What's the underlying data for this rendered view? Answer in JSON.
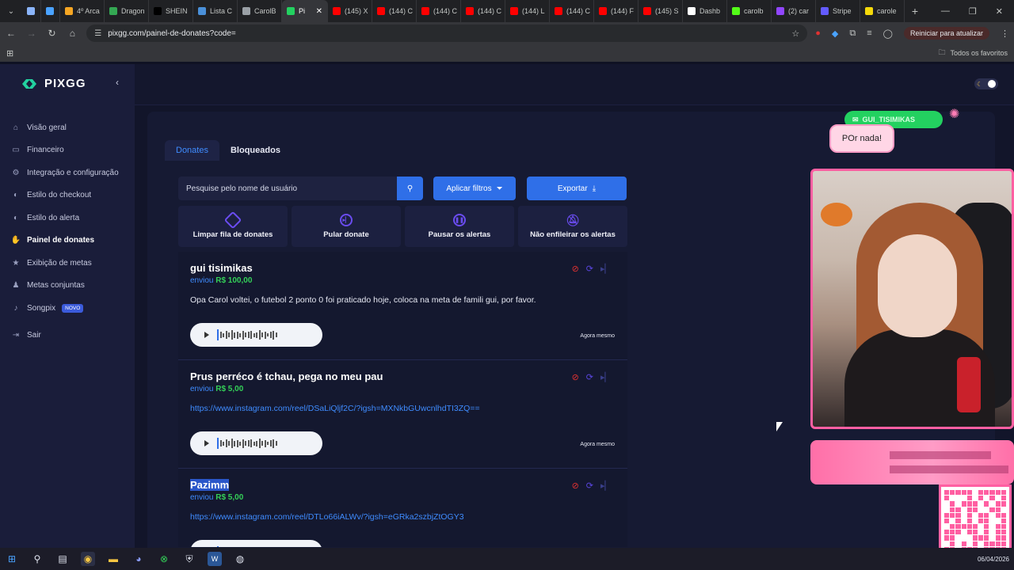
{
  "browser": {
    "tabs": [
      {
        "label": "",
        "color": "#8ab4f8"
      },
      {
        "label": "",
        "color": "#4aa3ff"
      },
      {
        "label": "4º Arca",
        "color": "#f5a623"
      },
      {
        "label": "Dragon",
        "color": "#34a853"
      },
      {
        "label": "SHEIN",
        "color": "#000000"
      },
      {
        "label": "Lista C",
        "color": "#4a90d9"
      },
      {
        "label": "CarolB",
        "color": "#9aa0a6"
      },
      {
        "label": "Pi",
        "color": "#23d160",
        "active": true
      },
      {
        "label": "(145) X",
        "color": "#ff0000"
      },
      {
        "label": "(144) C",
        "color": "#ff0000"
      },
      {
        "label": "(144) C",
        "color": "#ff0000"
      },
      {
        "label": "(144) C",
        "color": "#ff0000"
      },
      {
        "label": "(144) L",
        "color": "#ff0000"
      },
      {
        "label": "(144) C",
        "color": "#ff0000"
      },
      {
        "label": "(144) F",
        "color": "#ff0000"
      },
      {
        "label": "(145) S",
        "color": "#ff0000"
      },
      {
        "label": "Dashb",
        "color": "#ffffff"
      },
      {
        "label": "carolb",
        "color": "#53fc18"
      },
      {
        "label": "(2) car",
        "color": "#9146ff"
      },
      {
        "label": "Stripe",
        "color": "#635bff"
      },
      {
        "label": "carole",
        "color": "#f5d90a"
      }
    ],
    "url": "pixgg.com/painel-de-donates?code=",
    "update_label": "Reiniciar para atualizar",
    "bookmarks_label": "Todos os favoritos"
  },
  "brand": {
    "name": "PIXGG",
    "accent": "#2f6fe8"
  },
  "sidebar": {
    "items": [
      {
        "label": "Visão geral",
        "icon": "home-icon",
        "glyph": "⌂"
      },
      {
        "label": "Financeiro",
        "icon": "wallet-icon",
        "glyph": "▭"
      },
      {
        "label": "Integração e configuração",
        "icon": "plug-icon",
        "glyph": "⚙"
      },
      {
        "label": "Estilo do checkout",
        "icon": "palette-icon",
        "glyph": "◐"
      },
      {
        "label": "Estilo do alerta",
        "icon": "palette-icon",
        "glyph": "◐"
      },
      {
        "label": "Painel de donates",
        "icon": "hand-coin-icon",
        "glyph": "✋",
        "active": true
      },
      {
        "label": "Exibição de metas",
        "icon": "star-icon",
        "glyph": "★"
      },
      {
        "label": "Metas conjuntas",
        "icon": "group-icon",
        "glyph": "♟"
      },
      {
        "label": "Songpix",
        "icon": "music-icon",
        "glyph": "♪",
        "badge": "NOVO"
      },
      {
        "label": "Sair",
        "icon": "logout-icon",
        "glyph": "⇥"
      }
    ]
  },
  "main": {
    "tabs": [
      {
        "label": "Donates"
      },
      {
        "label": "Bloqueados"
      }
    ],
    "search_placeholder": "Pesquise pelo nome de usuário",
    "filter_label": "Aplicar filtros",
    "export_label": "Exportar",
    "actions": [
      {
        "label": "Limpar fila de donates",
        "icon": "eraser-icon"
      },
      {
        "label": "Pular donate",
        "icon": "skip-icon"
      },
      {
        "label": "Pausar os alertas",
        "icon": "pause-icon"
      },
      {
        "label": "Não enfileirar os alertas",
        "icon": "bell-off-icon"
      }
    ],
    "donates": [
      {
        "name": "gui tisimikas",
        "sent_prefix": "enviou",
        "amount": "R$ 100,00",
        "message": "Opa Carol voltei, o futebol 2 ponto 0 foi praticado hoje, coloca na meta de famili gui, por favor.",
        "is_link": false,
        "time": "Agora mesmo"
      },
      {
        "name": "Prus perréco é tchau, pega no meu pau",
        "sent_prefix": "enviou",
        "amount": "R$ 5,00",
        "message": "https://www.instagram.com/reel/DSaLiQljf2C/?igsh=MXNkbGUwcnlhdTI3ZQ==",
        "is_link": true,
        "time": "Agora mesmo"
      },
      {
        "name": "Pazimm",
        "name_highlight": "Pazimm",
        "sent_prefix": "enviou",
        "amount": "R$ 5,00",
        "message": "https://www.instagram.com/reel/DTLo66iALWv/?igsh=eGRka2szbjZtOGY3",
        "is_link": true,
        "time": ""
      }
    ]
  },
  "overlay": {
    "username": "GUI_TISIMIKAS",
    "bubble": "POr nada!"
  },
  "taskbar": {
    "date": "06/04/2026"
  }
}
